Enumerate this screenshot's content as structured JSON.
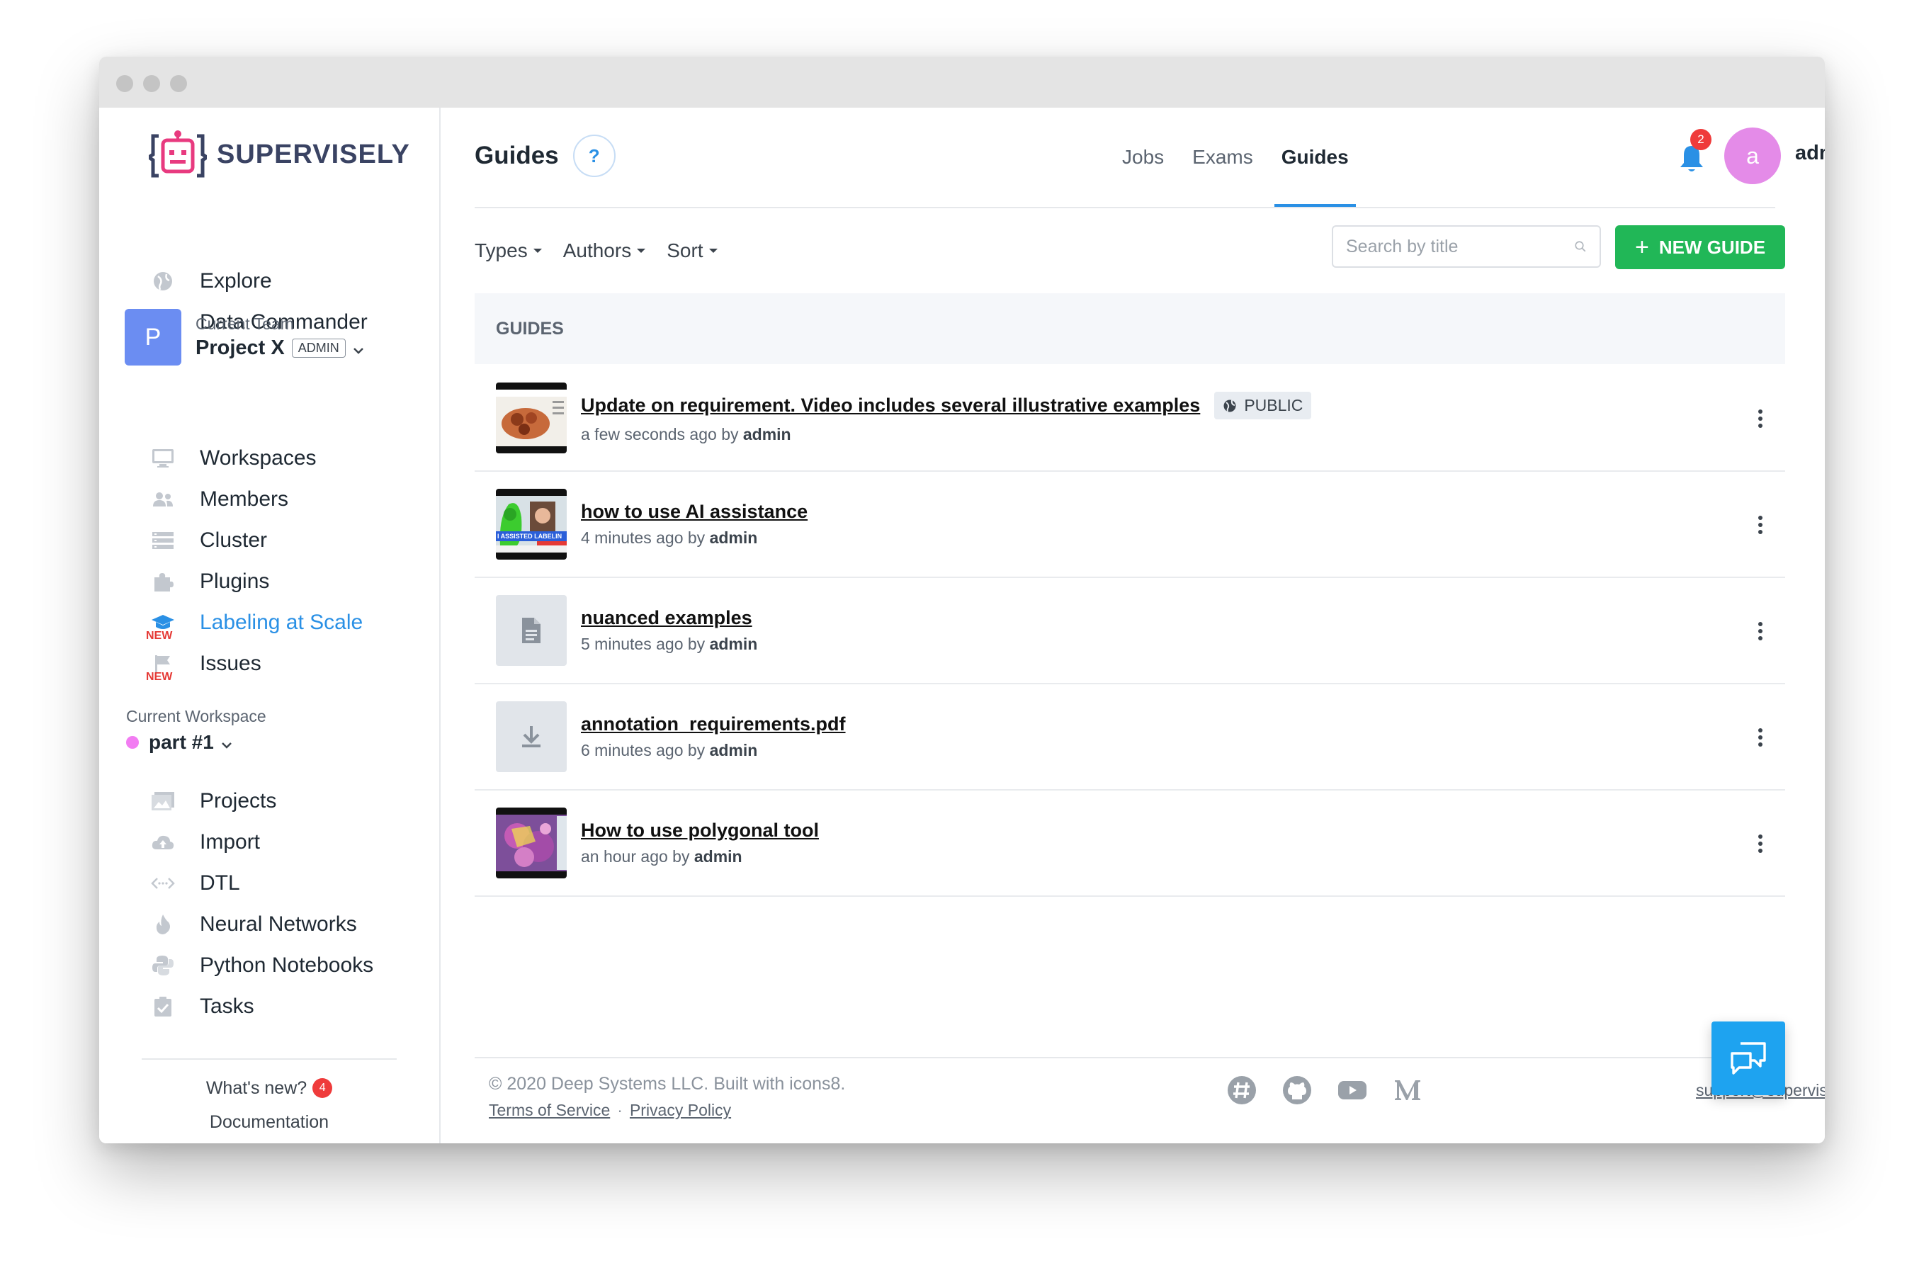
{
  "app": {
    "brand": "SUPERVISELY"
  },
  "sidebar": {
    "top_items": [
      {
        "label": "Explore",
        "icon": "globe-icon"
      },
      {
        "label": "Data Commander",
        "icon": "folder-star-icon"
      }
    ],
    "team": {
      "label": "Current Team",
      "avatar_letter": "P",
      "name": "Project X",
      "role": "ADMIN"
    },
    "team_items": [
      {
        "label": "Workspaces",
        "icon": "monitor-icon"
      },
      {
        "label": "Members",
        "icon": "people-icon"
      },
      {
        "label": "Cluster",
        "icon": "server-icon"
      },
      {
        "label": "Plugins",
        "icon": "puzzle-icon"
      },
      {
        "label": "Labeling at Scale",
        "icon": "graduation-cap-icon",
        "badge": "NEW",
        "active": true
      },
      {
        "label": "Issues",
        "icon": "flag-icon",
        "badge": "NEW"
      }
    ],
    "workspace": {
      "label": "Current Workspace",
      "name": "part #1",
      "dot_color": "#f27cf2"
    },
    "workspace_items": [
      {
        "label": "Projects",
        "icon": "images-icon"
      },
      {
        "label": "Import",
        "icon": "cloud-upload-icon"
      },
      {
        "label": "DTL",
        "icon": "code-icon"
      },
      {
        "label": "Neural Networks",
        "icon": "flame-icon"
      },
      {
        "label": "Python Notebooks",
        "icon": "python-icon"
      },
      {
        "label": "Tasks",
        "icon": "clipboard-check-icon"
      }
    ],
    "whats_new": {
      "label": "What's new?",
      "count": "4"
    },
    "documentation": "Documentation"
  },
  "header": {
    "title": "Guides",
    "help": "?",
    "tabs": [
      {
        "label": "Jobs",
        "active": false
      },
      {
        "label": "Exams",
        "active": false
      },
      {
        "label": "Guides",
        "active": true
      }
    ],
    "notifications": "2",
    "user": {
      "avatar_letter": "a",
      "name": "admin"
    }
  },
  "toolbar": {
    "filters": [
      "Types",
      "Authors",
      "Sort"
    ],
    "search_placeholder": "Search by title",
    "new_guide": "NEW GUIDE"
  },
  "list": {
    "header": "GUIDES",
    "guides": [
      {
        "title": "Update on requirement. Video includes several illustrative examples",
        "time": "a few seconds ago",
        "by": "by",
        "author": "admin",
        "badge": "PUBLIC",
        "thumb": "video-food"
      },
      {
        "title": "how to use AI assistance",
        "time": "4 minutes ago",
        "by": "by",
        "author": "admin",
        "thumb": "video-ai",
        "thumb_text": "I ASSISTED LABELIN"
      },
      {
        "title": "nuanced examples",
        "time": "5 minutes ago",
        "by": "by",
        "author": "admin",
        "thumb": "document-icon"
      },
      {
        "title": "annotation_requirements.pdf",
        "time": "6 minutes ago",
        "by": "by",
        "author": "admin",
        "thumb": "download-icon"
      },
      {
        "title": "How to use polygonal tool",
        "time": "an hour ago",
        "by": "by",
        "author": "admin",
        "thumb": "video-polygon"
      }
    ]
  },
  "footer": {
    "copyright": "© 2020 Deep Systems LLC. Built with icons8.",
    "terms": "Terms of Service",
    "separator": "·",
    "privacy": "Privacy Policy",
    "social": [
      "slack-icon",
      "github-icon",
      "youtube-icon",
      "medium-icon"
    ],
    "support": "support@supervisely"
  },
  "colors": {
    "accent": "#2a90e5",
    "green": "#21b757",
    "danger": "#ef3b3b",
    "team": "#6b8df2",
    "avatar": "#e48be8"
  }
}
